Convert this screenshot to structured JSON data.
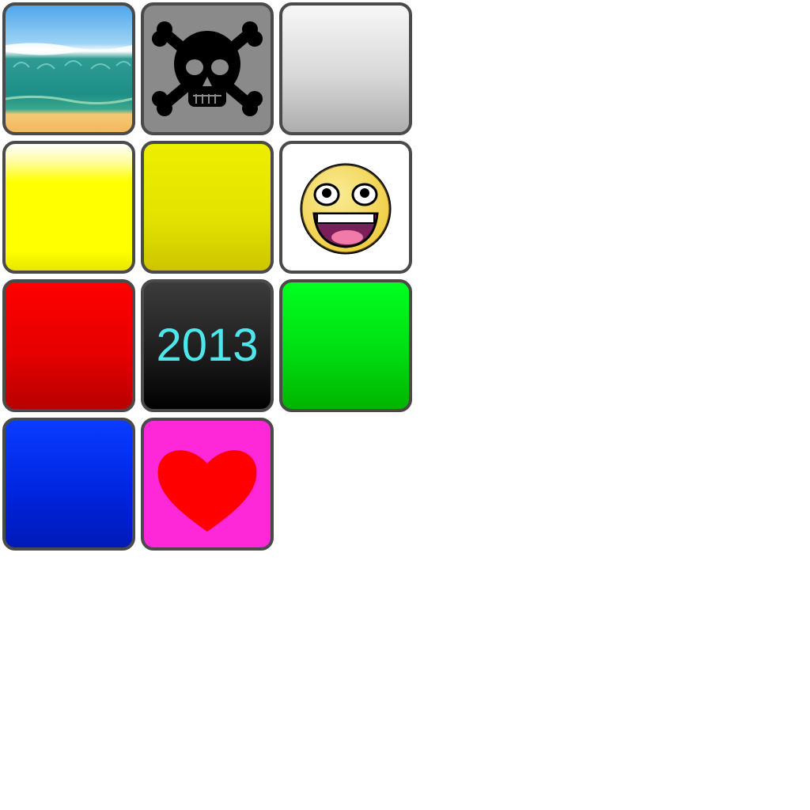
{
  "tiles": [
    {
      "id": "beach",
      "icon": "beach-waves-icon"
    },
    {
      "id": "skull",
      "icon": "skull-crossbones-icon"
    },
    {
      "id": "silver",
      "icon": "plain-silver-gradient"
    },
    {
      "id": "yellow-glow",
      "icon": "plain-yellow-gradient"
    },
    {
      "id": "yellow",
      "icon": "plain-yellow"
    },
    {
      "id": "smiley",
      "icon": "awesome-face-icon"
    },
    {
      "id": "red",
      "icon": "plain-red"
    },
    {
      "id": "year",
      "icon": "text-tile",
      "label": "2013"
    },
    {
      "id": "green",
      "icon": "plain-green"
    },
    {
      "id": "blue",
      "icon": "plain-blue"
    },
    {
      "id": "heart",
      "icon": "heart-icon"
    }
  ],
  "colors": {
    "border": "#4a4a4a",
    "year_text": "#4de6ea",
    "heart_bg": "#ff28d8",
    "heart": "#ff0000",
    "skull_bg": "#8a8a8a"
  }
}
